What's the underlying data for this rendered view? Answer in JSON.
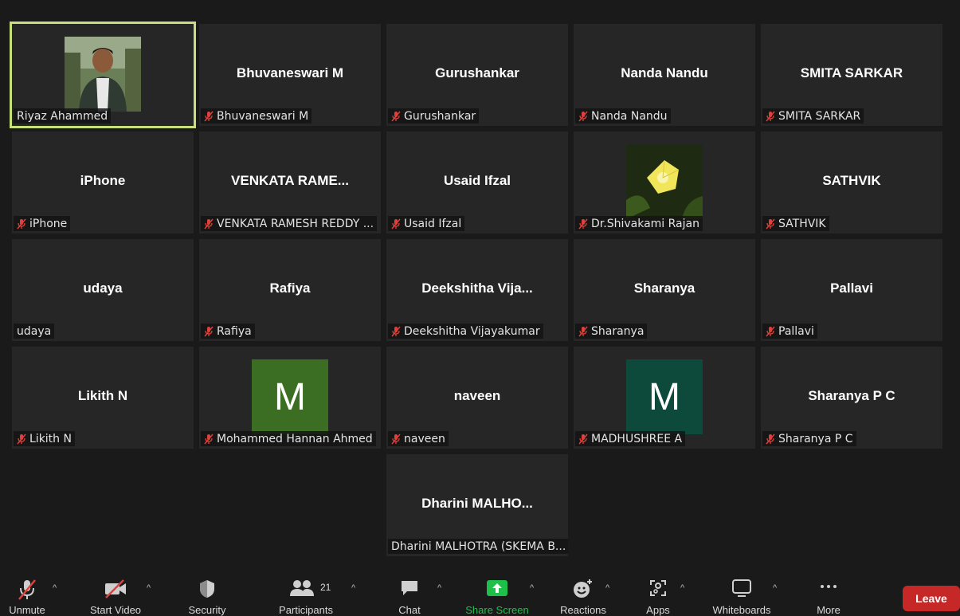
{
  "tiles": [
    {
      "big": "",
      "label": "Riyaz Ahammed",
      "muted": false,
      "type": "photo-person",
      "active": true
    },
    {
      "big": "Bhuvaneswari M",
      "label": "Bhuvaneswari M",
      "muted": true
    },
    {
      "big": "Gurushankar",
      "label": "Gurushankar",
      "muted": true
    },
    {
      "big": "Nanda Nandu",
      "label": "Nanda Nandu",
      "muted": true
    },
    {
      "big": "SMITA SARKAR",
      "label": "SMITA SARKAR",
      "muted": true
    },
    {
      "big": "iPhone",
      "label": "iPhone",
      "muted": true
    },
    {
      "big": "VENKATA  RAME...",
      "label": "VENKATA RAMESH REDDY ...",
      "muted": true
    },
    {
      "big": "Usaid Ifzal",
      "label": "Usaid Ifzal",
      "muted": true
    },
    {
      "big": "",
      "label": "Dr.Shivakami Rajan",
      "muted": true,
      "type": "photo-flower"
    },
    {
      "big": "SATHVIK",
      "label": "SATHVIK",
      "muted": true
    },
    {
      "big": "udaya",
      "label": "udaya",
      "muted": false
    },
    {
      "big": "Rafiya",
      "label": "Rafiya",
      "muted": true
    },
    {
      "big": "Deekshitha  Vija...",
      "label": "Deekshitha Vijayakumar",
      "muted": true
    },
    {
      "big": "Sharanya",
      "label": "Sharanya",
      "muted": true
    },
    {
      "big": "Pallavi",
      "label": "Pallavi",
      "muted": true
    },
    {
      "big": "Likith N",
      "label": "Likith N",
      "muted": true
    },
    {
      "big": "",
      "avatar": "M",
      "avatar_color": "#3b6e22",
      "label": "Mohammed Hannan Ahmed",
      "muted": true
    },
    {
      "big": "naveen",
      "label": "naveen",
      "muted": true
    },
    {
      "big": "",
      "avatar": "M",
      "avatar_color": "#0e4a3c",
      "label": "MADHUSHREE A",
      "muted": true
    },
    {
      "big": "Sharanya P C",
      "label": "Sharanya P C",
      "muted": true
    },
    {
      "big": "Dharini  MALHO...",
      "label": "Dharini MALHOTRA (SKEMA B...",
      "muted": false
    }
  ],
  "toolbar": {
    "unmute": "Unmute",
    "start_video": "Start Video",
    "security": "Security",
    "participants": "Participants",
    "participants_count": "21",
    "chat": "Chat",
    "share_screen": "Share Screen",
    "reactions": "Reactions",
    "apps": "Apps",
    "whiteboards": "Whiteboards",
    "more": "More",
    "leave": "Leave"
  },
  "colors": {
    "active_outline": "#c8e07a",
    "share_green": "#1fc04a",
    "leave_red": "#c62828",
    "mute_red": "#e0403a"
  }
}
